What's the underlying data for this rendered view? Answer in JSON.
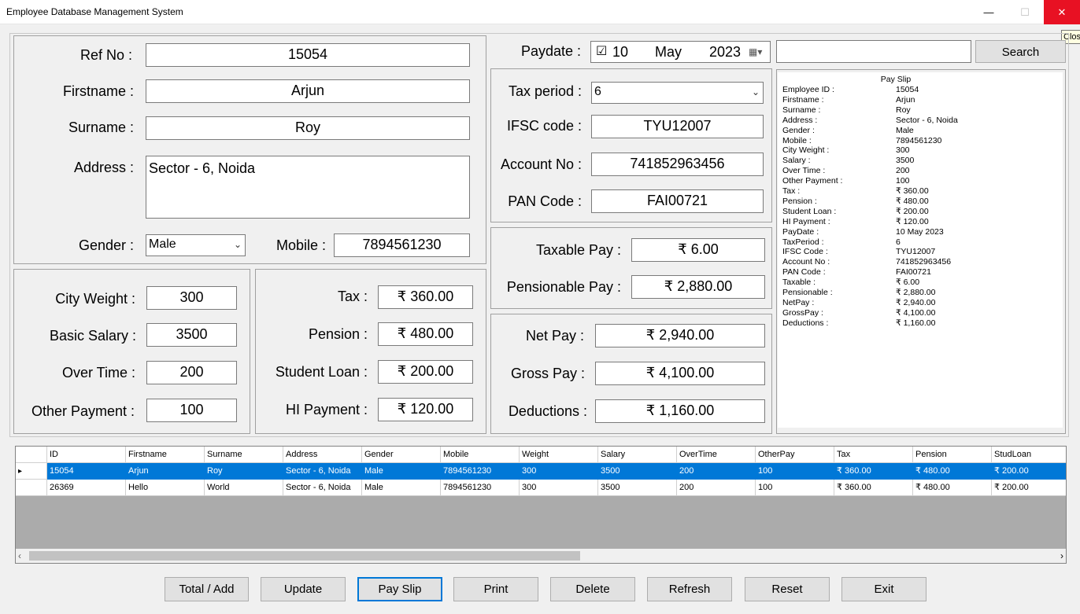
{
  "window": {
    "title": "Employee Database Management System",
    "minimize_glyph": "—",
    "maximize_glyph": "☐",
    "close_glyph": "✕",
    "close_tooltip": "Close"
  },
  "employee": {
    "ref_label": "Ref No :",
    "ref_value": "15054",
    "firstname_label": "Firstname :",
    "firstname_value": "Arjun",
    "surname_label": "Surname :",
    "surname_value": "Roy",
    "address_label": "Address :",
    "address_value": "Sector - 6, Noida",
    "gender_label": "Gender :",
    "gender_value": "Male",
    "mobile_label": "Mobile :",
    "mobile_value": "7894561230"
  },
  "salary": {
    "city_label": "City Weight :",
    "city_value": "300",
    "basic_label": "Basic Salary :",
    "basic_value": "3500",
    "overtime_label": "Over Time :",
    "overtime_value": "200",
    "other_label": "Other Payment :",
    "other_value": "100"
  },
  "deductions_box": {
    "tax_label": "Tax :",
    "tax_value": "₹ 360.00",
    "pension_label": "Pension :",
    "pension_value": "₹ 480.00",
    "student_label": "Student Loan :",
    "student_value": "₹ 200.00",
    "hi_label": "HI Payment :",
    "hi_value": "₹ 120.00"
  },
  "paydate": {
    "label": "Paydate :",
    "checkbox": "☑",
    "day": "10",
    "month": "May",
    "year": "2023",
    "cal_icon": "▦▾"
  },
  "search": {
    "input_value": "",
    "button_label": "Search"
  },
  "tax_info": {
    "period_label": "Tax period :",
    "period_value": "6",
    "ifsc_label": "IFSC code :",
    "ifsc_value": "TYU12007",
    "account_label": "Account No :",
    "account_value": "741852963456",
    "pan_label": "PAN Code :",
    "pan_value": "FAI00721"
  },
  "pay_calc": {
    "taxable_label": "Taxable Pay :",
    "taxable_value": "₹ 6.00",
    "pensionable_label": "Pensionable Pay :",
    "pensionable_value": "₹ 2,880.00"
  },
  "totals": {
    "net_label": "Net Pay :",
    "net_value": "₹ 2,940.00",
    "gross_label": "Gross Pay :",
    "gross_value": "₹ 4,100.00",
    "ded_label": "Deductions :",
    "ded_value": "₹ 1,160.00"
  },
  "payslip": {
    "title": "Pay Slip",
    "rows": [
      {
        "k": "Employee ID :",
        "v": "15054"
      },
      {
        "k": "Firstname :",
        "v": "Arjun"
      },
      {
        "k": "Surname :",
        "v": "Roy"
      },
      {
        "k": "Address :",
        "v": "Sector - 6, Noida"
      },
      {
        "k": "Gender :",
        "v": "Male"
      },
      {
        "k": "Mobile :",
        "v": "7894561230"
      },
      {
        "k": "City Weight :",
        "v": "300"
      },
      {
        "k": "Salary :",
        "v": "3500"
      },
      {
        "k": "Over Time :",
        "v": "200"
      },
      {
        "k": "Other Payment :",
        "v": "100"
      },
      {
        "k": "Tax :",
        "v": "₹ 360.00"
      },
      {
        "k": "Pension :",
        "v": "₹ 480.00"
      },
      {
        "k": "Student Loan :",
        "v": "₹ 200.00"
      },
      {
        "k": "HI Payment :",
        "v": "₹ 120.00"
      },
      {
        "k": "PayDate :",
        "v": "10 May 2023"
      },
      {
        "k": "TaxPeriod :",
        "v": "6"
      },
      {
        "k": "IFSC Code :",
        "v": "TYU12007"
      },
      {
        "k": "Account No :",
        "v": "741852963456"
      },
      {
        "k": "PAN Code :",
        "v": "FAI00721"
      },
      {
        "k": "Taxable :",
        "v": "₹ 6.00"
      },
      {
        "k": "Pensionable :",
        "v": "₹ 2,880.00"
      },
      {
        "k": "NetPay :",
        "v": "₹ 2,940.00"
      },
      {
        "k": "GrossPay :",
        "v": "₹ 4,100.00"
      },
      {
        "k": "Deductions :",
        "v": "₹ 1,160.00"
      }
    ]
  },
  "grid": {
    "selector_glyph": "▸",
    "columns": [
      "ID",
      "Firstname",
      "Surname",
      "Address",
      "Gender",
      "Mobile",
      "Weight",
      "Salary",
      "OverTime",
      "OtherPay",
      "Tax",
      "Pension",
      "StudLoan"
    ],
    "rows": [
      [
        "15054",
        "Arjun",
        "Roy",
        "Sector - 6, Noida",
        "Male",
        "7894561230",
        "300",
        "3500",
        "200",
        "100",
        "₹ 360.00",
        "₹ 480.00",
        "₹ 200.00"
      ],
      [
        "26369",
        "Hello",
        "World",
        "Sector - 6, Noida",
        "Male",
        "7894561230",
        "300",
        "3500",
        "200",
        "100",
        "₹ 360.00",
        "₹ 480.00",
        "₹ 200.00"
      ]
    ],
    "scroll_left": "‹",
    "scroll_right": "›"
  },
  "buttons": {
    "total_add": "Total / Add",
    "update": "Update",
    "pay_slip": "Pay Slip",
    "print": "Print",
    "delete": "Delete",
    "refresh": "Refresh",
    "reset": "Reset",
    "exit": "Exit"
  },
  "colors": {
    "selection": "#0078d7",
    "close_button": "#e81123",
    "form_bg": "#f0f0f0"
  }
}
